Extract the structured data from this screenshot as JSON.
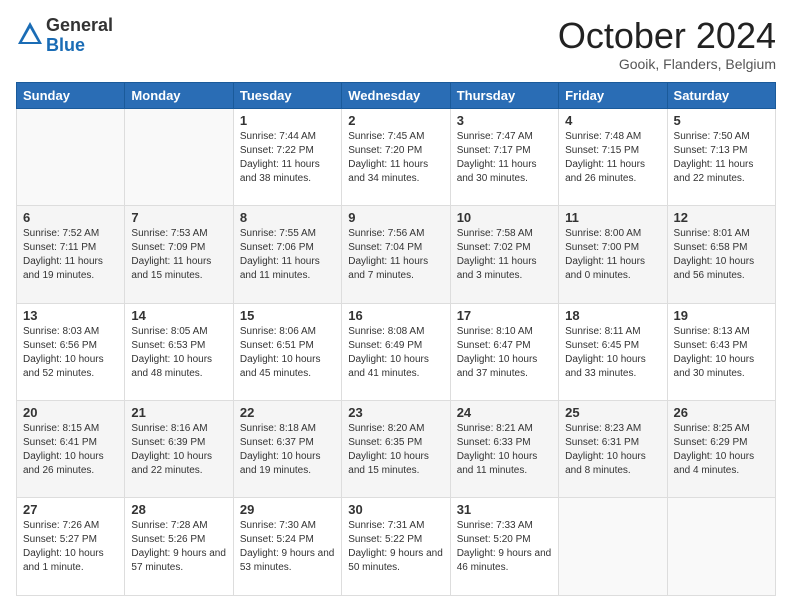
{
  "logo": {
    "general": "General",
    "blue": "Blue"
  },
  "header": {
    "month": "October 2024",
    "location": "Gooik, Flanders, Belgium"
  },
  "weekdays": [
    "Sunday",
    "Monday",
    "Tuesday",
    "Wednesday",
    "Thursday",
    "Friday",
    "Saturday"
  ],
  "weeks": [
    [
      {
        "day": "",
        "sunrise": "",
        "sunset": "",
        "daylight": ""
      },
      {
        "day": "",
        "sunrise": "",
        "sunset": "",
        "daylight": ""
      },
      {
        "day": "1",
        "sunrise": "Sunrise: 7:44 AM",
        "sunset": "Sunset: 7:22 PM",
        "daylight": "Daylight: 11 hours and 38 minutes."
      },
      {
        "day": "2",
        "sunrise": "Sunrise: 7:45 AM",
        "sunset": "Sunset: 7:20 PM",
        "daylight": "Daylight: 11 hours and 34 minutes."
      },
      {
        "day": "3",
        "sunrise": "Sunrise: 7:47 AM",
        "sunset": "Sunset: 7:17 PM",
        "daylight": "Daylight: 11 hours and 30 minutes."
      },
      {
        "day": "4",
        "sunrise": "Sunrise: 7:48 AM",
        "sunset": "Sunset: 7:15 PM",
        "daylight": "Daylight: 11 hours and 26 minutes."
      },
      {
        "day": "5",
        "sunrise": "Sunrise: 7:50 AM",
        "sunset": "Sunset: 7:13 PM",
        "daylight": "Daylight: 11 hours and 22 minutes."
      }
    ],
    [
      {
        "day": "6",
        "sunrise": "Sunrise: 7:52 AM",
        "sunset": "Sunset: 7:11 PM",
        "daylight": "Daylight: 11 hours and 19 minutes."
      },
      {
        "day": "7",
        "sunrise": "Sunrise: 7:53 AM",
        "sunset": "Sunset: 7:09 PM",
        "daylight": "Daylight: 11 hours and 15 minutes."
      },
      {
        "day": "8",
        "sunrise": "Sunrise: 7:55 AM",
        "sunset": "Sunset: 7:06 PM",
        "daylight": "Daylight: 11 hours and 11 minutes."
      },
      {
        "day": "9",
        "sunrise": "Sunrise: 7:56 AM",
        "sunset": "Sunset: 7:04 PM",
        "daylight": "Daylight: 11 hours and 7 minutes."
      },
      {
        "day": "10",
        "sunrise": "Sunrise: 7:58 AM",
        "sunset": "Sunset: 7:02 PM",
        "daylight": "Daylight: 11 hours and 3 minutes."
      },
      {
        "day": "11",
        "sunrise": "Sunrise: 8:00 AM",
        "sunset": "Sunset: 7:00 PM",
        "daylight": "Daylight: 11 hours and 0 minutes."
      },
      {
        "day": "12",
        "sunrise": "Sunrise: 8:01 AM",
        "sunset": "Sunset: 6:58 PM",
        "daylight": "Daylight: 10 hours and 56 minutes."
      }
    ],
    [
      {
        "day": "13",
        "sunrise": "Sunrise: 8:03 AM",
        "sunset": "Sunset: 6:56 PM",
        "daylight": "Daylight: 10 hours and 52 minutes."
      },
      {
        "day": "14",
        "sunrise": "Sunrise: 8:05 AM",
        "sunset": "Sunset: 6:53 PM",
        "daylight": "Daylight: 10 hours and 48 minutes."
      },
      {
        "day": "15",
        "sunrise": "Sunrise: 8:06 AM",
        "sunset": "Sunset: 6:51 PM",
        "daylight": "Daylight: 10 hours and 45 minutes."
      },
      {
        "day": "16",
        "sunrise": "Sunrise: 8:08 AM",
        "sunset": "Sunset: 6:49 PM",
        "daylight": "Daylight: 10 hours and 41 minutes."
      },
      {
        "day": "17",
        "sunrise": "Sunrise: 8:10 AM",
        "sunset": "Sunset: 6:47 PM",
        "daylight": "Daylight: 10 hours and 37 minutes."
      },
      {
        "day": "18",
        "sunrise": "Sunrise: 8:11 AM",
        "sunset": "Sunset: 6:45 PM",
        "daylight": "Daylight: 10 hours and 33 minutes."
      },
      {
        "day": "19",
        "sunrise": "Sunrise: 8:13 AM",
        "sunset": "Sunset: 6:43 PM",
        "daylight": "Daylight: 10 hours and 30 minutes."
      }
    ],
    [
      {
        "day": "20",
        "sunrise": "Sunrise: 8:15 AM",
        "sunset": "Sunset: 6:41 PM",
        "daylight": "Daylight: 10 hours and 26 minutes."
      },
      {
        "day": "21",
        "sunrise": "Sunrise: 8:16 AM",
        "sunset": "Sunset: 6:39 PM",
        "daylight": "Daylight: 10 hours and 22 minutes."
      },
      {
        "day": "22",
        "sunrise": "Sunrise: 8:18 AM",
        "sunset": "Sunset: 6:37 PM",
        "daylight": "Daylight: 10 hours and 19 minutes."
      },
      {
        "day": "23",
        "sunrise": "Sunrise: 8:20 AM",
        "sunset": "Sunset: 6:35 PM",
        "daylight": "Daylight: 10 hours and 15 minutes."
      },
      {
        "day": "24",
        "sunrise": "Sunrise: 8:21 AM",
        "sunset": "Sunset: 6:33 PM",
        "daylight": "Daylight: 10 hours and 11 minutes."
      },
      {
        "day": "25",
        "sunrise": "Sunrise: 8:23 AM",
        "sunset": "Sunset: 6:31 PM",
        "daylight": "Daylight: 10 hours and 8 minutes."
      },
      {
        "day": "26",
        "sunrise": "Sunrise: 8:25 AM",
        "sunset": "Sunset: 6:29 PM",
        "daylight": "Daylight: 10 hours and 4 minutes."
      }
    ],
    [
      {
        "day": "27",
        "sunrise": "Sunrise: 7:26 AM",
        "sunset": "Sunset: 5:27 PM",
        "daylight": "Daylight: 10 hours and 1 minute."
      },
      {
        "day": "28",
        "sunrise": "Sunrise: 7:28 AM",
        "sunset": "Sunset: 5:26 PM",
        "daylight": "Daylight: 9 hours and 57 minutes."
      },
      {
        "day": "29",
        "sunrise": "Sunrise: 7:30 AM",
        "sunset": "Sunset: 5:24 PM",
        "daylight": "Daylight: 9 hours and 53 minutes."
      },
      {
        "day": "30",
        "sunrise": "Sunrise: 7:31 AM",
        "sunset": "Sunset: 5:22 PM",
        "daylight": "Daylight: 9 hours and 50 minutes."
      },
      {
        "day": "31",
        "sunrise": "Sunrise: 7:33 AM",
        "sunset": "Sunset: 5:20 PM",
        "daylight": "Daylight: 9 hours and 46 minutes."
      },
      {
        "day": "",
        "sunrise": "",
        "sunset": "",
        "daylight": ""
      },
      {
        "day": "",
        "sunrise": "",
        "sunset": "",
        "daylight": ""
      }
    ]
  ]
}
